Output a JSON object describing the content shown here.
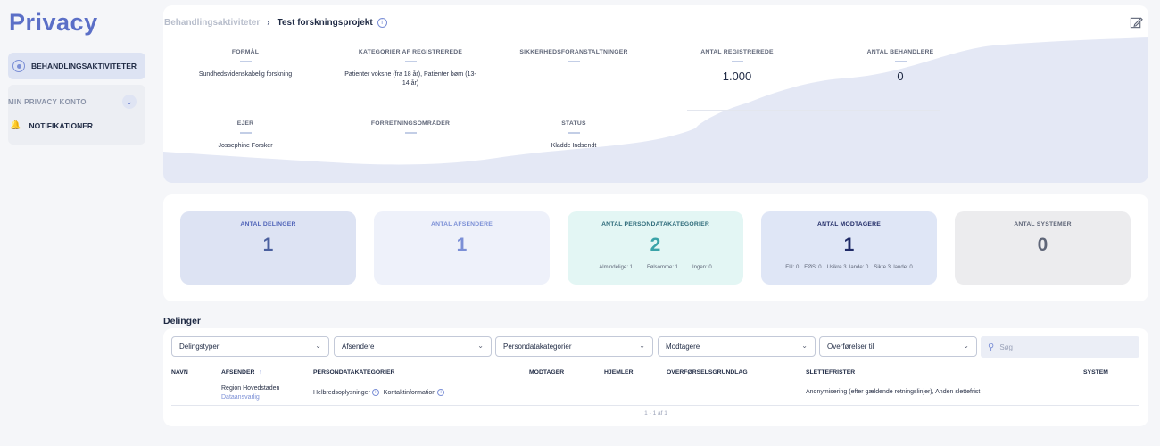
{
  "app": {
    "title": "Privacy"
  },
  "sidebar": {
    "active_item": "BEHANDLINGSAKTIVITETER",
    "group_title": "MIN PRIVACY KONTO",
    "items": [
      {
        "label": "NOTIFIKATIONER",
        "icon": "bell-icon"
      }
    ]
  },
  "breadcrumb": {
    "parent": "Behandlingsaktiviteter",
    "current": "Test forskningsprojekt"
  },
  "overview": {
    "formaal": {
      "label": "FORMÅL",
      "value": "Sundhedsvidenskabelig forskning"
    },
    "kategorier": {
      "label": "KATEGORIER AF REGISTREREDE",
      "value": "Patienter voksne (fra 18 år), Patienter børn (13-14 år)"
    },
    "sikkerhed": {
      "label": "SIKKERHEDSFORANSTALTNINGER",
      "value": ""
    },
    "registrerede": {
      "label": "ANTAL REGISTREREDE",
      "value": "1.000"
    },
    "behandlere": {
      "label": "ANTAL BEHANDLERE",
      "value": "0"
    },
    "ejer": {
      "label": "EJER",
      "value": "Jossephine Forsker"
    },
    "forretning": {
      "label": "FORRETNINGSOMRÅDER",
      "value": ""
    },
    "status": {
      "label": "STATUS",
      "value": "Kladde Indsendt"
    }
  },
  "stats": {
    "delinger": {
      "label": "ANTAL DELINGER",
      "value": "1"
    },
    "afsendere": {
      "label": "ANTAL AFSENDERE",
      "value": "1"
    },
    "persondata": {
      "label": "ANTAL PERSONDATAKATEGORIER",
      "value": "2",
      "sub": [
        "Almindelige: 1",
        "Følsomme: 1",
        "Ingen: 0"
      ]
    },
    "modtagere": {
      "label": "ANTAL MODTAGERE",
      "value": "1",
      "sub": [
        "EU: 0",
        "EØS: 0",
        "Usikre 3. lande: 0",
        "Sikre 3. lande: 0"
      ]
    },
    "systemer": {
      "label": "ANTAL SYSTEMER",
      "value": "0"
    }
  },
  "colors": {
    "accent": "#5b6fc7",
    "stat_blue_dark": "#dde3f3",
    "stat_blue_light": "#eef1fa",
    "stat_teal": "#e3f6f4",
    "stat_grey": "#ececee"
  },
  "delinger": {
    "title": "Delinger",
    "filters": [
      "Delingstyper",
      "Afsendere",
      "Persondatakategorier",
      "Modtagere",
      "Overførelser til"
    ],
    "search_placeholder": "Søg",
    "columns": [
      "NAVN",
      "AFSENDER",
      "PERSONDATAKATEGORIER",
      "MODTAGER",
      "HJEMLER",
      "OVERFØRSELSGRUNDLAG",
      "SLETTEFRISTER",
      "SYSTEM"
    ],
    "rows": [
      {
        "navn": "",
        "afsender": "Region Hovedstaden",
        "afsender_role": "Dataansvarlig",
        "persondata": [
          "Helbredsoplysninger",
          "Kontaktinformation"
        ],
        "modtager": "",
        "hjemler": "",
        "overfoersel": "",
        "slettefrister": "Anonymisering (efter gældende retningslinjer), Anden slettefrist",
        "system": ""
      }
    ],
    "pagination": "1 - 1 af 1"
  }
}
